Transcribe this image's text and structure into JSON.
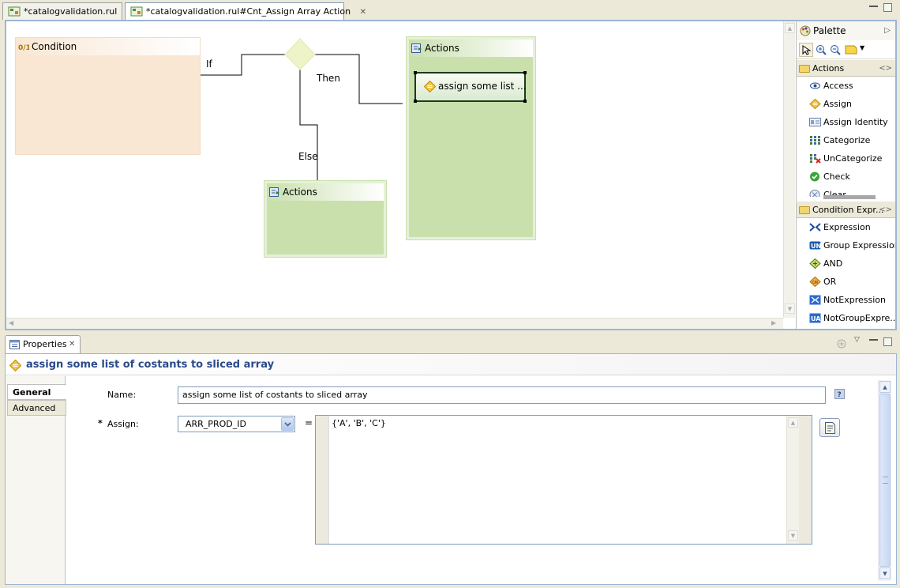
{
  "tabs": [
    {
      "label": "*catalogvalidation.rul"
    },
    {
      "label": "*catalogvalidation.rul#Cnt_Assign Array Action"
    }
  ],
  "diagram": {
    "condition_title": "Condition",
    "if_label": "If",
    "then_label": "Then",
    "else_label": "Else",
    "then_actions_title": "Actions",
    "else_actions_title": "Actions",
    "assign_node_label": "assign some list ..."
  },
  "palette": {
    "title": "Palette",
    "actions_category": "Actions",
    "actions": [
      {
        "label": "Access",
        "icon": "eye-icon"
      },
      {
        "label": "Assign",
        "icon": "assign-icon"
      },
      {
        "label": "Assign Identity",
        "icon": "identity-card-icon"
      },
      {
        "label": "Categorize",
        "icon": "categorize-grid-icon"
      },
      {
        "label": "UnCategorize",
        "icon": "uncategorize-grid-icon"
      },
      {
        "label": "Check",
        "icon": "check-icon"
      },
      {
        "label": "Clear",
        "icon": "clear-icon"
      }
    ],
    "conditions_category": "Condition Expr...",
    "conditions": [
      {
        "label": "Expression",
        "icon": "expression-icon"
      },
      {
        "label": "Group Expression",
        "icon": "group-expression-icon"
      },
      {
        "label": "AND",
        "icon": "and-icon"
      },
      {
        "label": "OR",
        "icon": "or-icon"
      },
      {
        "label": "NotExpression",
        "icon": "not-expression-icon"
      },
      {
        "label": "NotGroupExpre...",
        "icon": "not-group-expression-icon"
      }
    ]
  },
  "properties": {
    "tab_label": "Properties",
    "title": "assign some list of costants to sliced array",
    "side_tabs": [
      {
        "label": "General"
      },
      {
        "label": "Advanced"
      }
    ],
    "name_label": "Name:",
    "name_value": "assign some list of costants to sliced array",
    "required_marker": "*",
    "assign_label": "Assign:",
    "assign_value": "ARR_PROD_ID",
    "equals": "=",
    "expression_value": "{'A', 'B', 'C'}"
  },
  "colors": {
    "condition_fill": "#f9e7d3",
    "actions_fill": "#c9e0ad",
    "diamond_fill": "#eef3c8",
    "title_blue": "#2a4a8a"
  }
}
